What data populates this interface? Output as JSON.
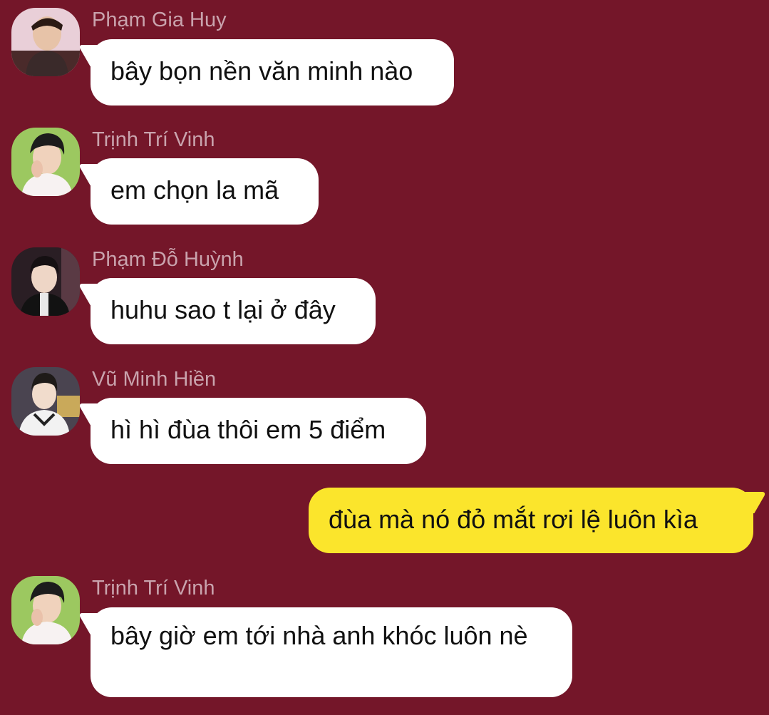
{
  "colors": {
    "background": "#741629",
    "incoming_bubble": "#ffffff",
    "outgoing_bubble": "#fbe52c",
    "sender_name": "#c9a3ad"
  },
  "messages": [
    {
      "sender": "Phạm Gia Huy",
      "text": "bây bọn nền văn minh nào",
      "direction": "incoming"
    },
    {
      "sender": "Trịnh Trí Vinh",
      "text": "em chọn la mã",
      "direction": "incoming"
    },
    {
      "sender": "Phạm Đỗ Huỳnh",
      "text": "huhu sao t lại ở đây",
      "direction": "incoming"
    },
    {
      "sender": "Vũ Minh Hiền",
      "text": "hì hì đùa thôi em 5 điểm",
      "direction": "incoming"
    },
    {
      "sender": "",
      "text": "đùa mà nó đỏ mắt rơi lệ luôn kìa",
      "direction": "outgoing"
    },
    {
      "sender": "Trịnh Trí Vinh",
      "text": "bây giờ em tới nhà anh khóc luôn nè",
      "direction": "incoming"
    }
  ]
}
